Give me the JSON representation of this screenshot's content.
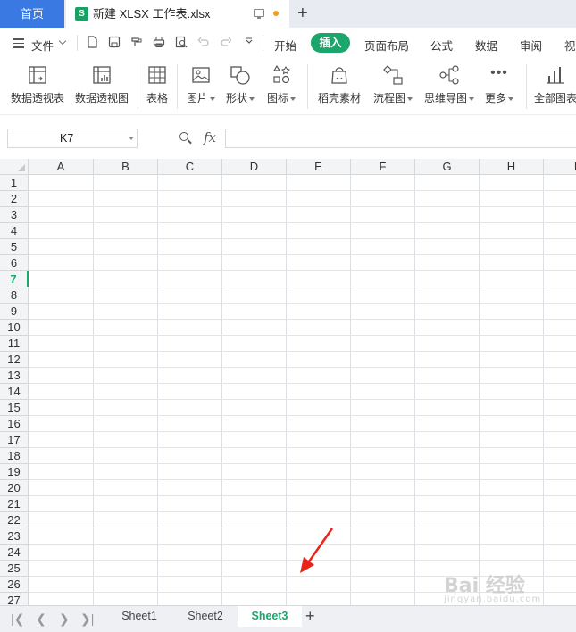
{
  "titlebar": {
    "home_tab": "首页",
    "doc_icon_letter": "S",
    "doc_title": "新建 XLSX 工作表.xlsx",
    "new_tab": "+"
  },
  "menubar": {
    "file_label": "文件",
    "items": [
      "开始",
      "插入",
      "页面布局",
      "公式",
      "数据",
      "审阅",
      "视"
    ],
    "active": "插入"
  },
  "ribbon": {
    "buttons": [
      {
        "label": "数据透视表",
        "icon": "pivot-table-icon"
      },
      {
        "label": "数据透视图",
        "icon": "pivot-chart-icon"
      },
      {
        "label": "表格",
        "icon": "table-icon"
      },
      {
        "label": "图片",
        "icon": "picture-icon"
      },
      {
        "label": "形状",
        "icon": "shape-icon"
      },
      {
        "label": "图标",
        "icon": "icons-icon"
      },
      {
        "label": "稻壳素材",
        "icon": "docer-material-icon"
      },
      {
        "label": "流程图",
        "icon": "flowchart-icon"
      },
      {
        "label": "思维导图",
        "icon": "mindmap-icon"
      },
      {
        "label": "更多",
        "icon": "more-icon"
      },
      {
        "label": "全部图表",
        "icon": "all-charts-icon"
      }
    ]
  },
  "formula_bar": {
    "name_box": "K7",
    "fx": "fx",
    "formula": ""
  },
  "grid": {
    "columns": [
      "A",
      "B",
      "C",
      "D",
      "E",
      "F",
      "G",
      "H",
      "I"
    ],
    "rows": [
      "1",
      "2",
      "3",
      "4",
      "5",
      "6",
      "7",
      "8",
      "9",
      "10",
      "11",
      "12",
      "13",
      "14",
      "15",
      "16",
      "17",
      "18",
      "19",
      "20",
      "21",
      "22",
      "23",
      "24",
      "25",
      "26",
      "27"
    ],
    "active_row": "7"
  },
  "sheets": {
    "tabs": [
      "Sheet1",
      "Sheet2",
      "Sheet3"
    ],
    "active": "Sheet3",
    "add": "+"
  },
  "colors": {
    "accent": "#1ba66c",
    "home_tab": "#3a78e2",
    "arrow": "#e8241b"
  },
  "watermark": {
    "text": "Bai 经验",
    "sub": "jingyan.baidu.com"
  }
}
